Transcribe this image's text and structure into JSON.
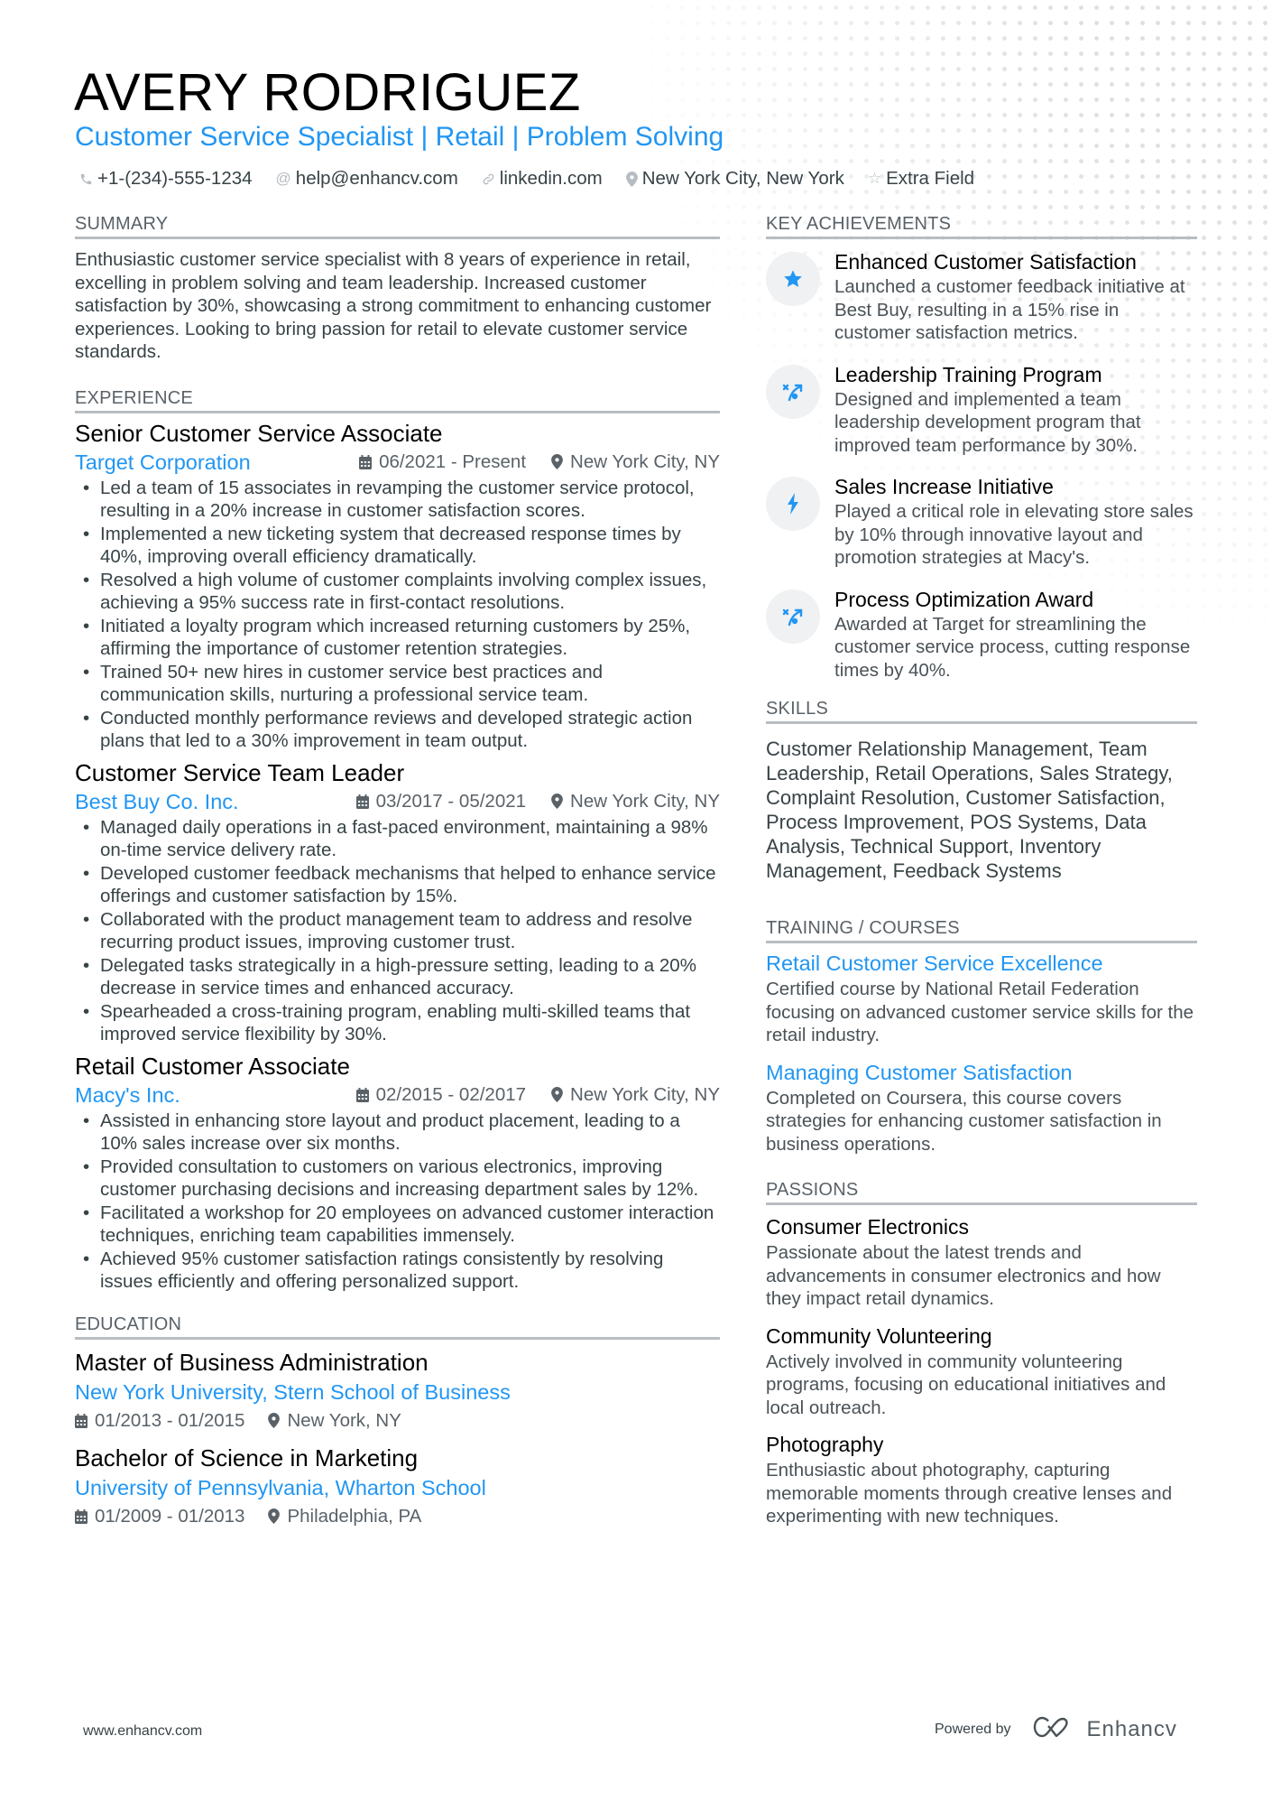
{
  "header": {
    "name": "AVERY RODRIGUEZ",
    "subtitle": "Customer Service Specialist | Retail | Problem Solving",
    "contacts": [
      {
        "icon": "phone-icon",
        "text": "+1-(234)-555-1234"
      },
      {
        "icon": "at-icon",
        "text": "help@enhancv.com"
      },
      {
        "icon": "link-icon",
        "text": "linkedin.com"
      },
      {
        "icon": "location-icon",
        "text": "New York City, New York"
      },
      {
        "icon": "star-outline-icon",
        "text": "Extra Field"
      }
    ]
  },
  "summary": {
    "title": "SUMMARY",
    "text": "Enthusiastic customer service specialist with 8 years of experience in retail, excelling in problem solving and team leadership. Increased customer satisfaction by 30%, showcasing a strong commitment to enhancing customer experiences. Looking to bring passion for retail to elevate customer service standards."
  },
  "experience": {
    "title": "EXPERIENCE",
    "jobs": [
      {
        "title": "Senior Customer Service Associate",
        "company": "Target Corporation",
        "dates": "06/2021 - Present",
        "location": "New York City, NY",
        "bullets": [
          "Led a team of 15 associates in revamping the customer service protocol, resulting in a 20% increase in customer satisfaction scores.",
          "Implemented a new ticketing system that decreased response times by 40%, improving overall efficiency dramatically.",
          "Resolved a high volume of customer complaints involving complex issues, achieving a 95% success rate in first-contact resolutions.",
          "Initiated a loyalty program which increased returning customers by 25%, affirming the importance of customer retention strategies.",
          "Trained 50+ new hires in customer service best practices and communication skills, nurturing a professional service team.",
          "Conducted monthly performance reviews and developed strategic action plans that led to a 30% improvement in team output."
        ]
      },
      {
        "title": "Customer Service Team Leader",
        "company": "Best Buy Co. Inc.",
        "dates": "03/2017 - 05/2021",
        "location": "New York City, NY",
        "bullets": [
          "Managed daily operations in a fast-paced environment, maintaining a 98% on-time service delivery rate.",
          "Developed customer feedback mechanisms that helped to enhance service offerings and customer satisfaction by 15%.",
          "Collaborated with the product management team to address and resolve recurring product issues, improving customer trust.",
          "Delegated tasks strategically in a high-pressure setting, leading to a 20% decrease in service times and enhanced accuracy.",
          "Spearheaded a cross-training program, enabling multi-skilled teams that improved service flexibility by 30%."
        ]
      },
      {
        "title": "Retail Customer Associate",
        "company": "Macy's Inc.",
        "dates": "02/2015 - 02/2017",
        "location": "New York City, NY",
        "bullets": [
          "Assisted in enhancing store layout and product placement, leading to a 10% sales increase over six months.",
          "Provided consultation to customers on various electronics, improving customer purchasing decisions and increasing department sales by 12%.",
          "Facilitated a workshop for 20 employees on advanced customer interaction techniques, enriching team capabilities immensely.",
          "Achieved 95% customer satisfaction ratings consistently by resolving issues efficiently and offering personalized support."
        ]
      }
    ]
  },
  "education": {
    "title": "EDUCATION",
    "items": [
      {
        "degree": "Master of Business Administration",
        "school": "New York University, Stern School of Business",
        "dates": "01/2013 - 01/2015",
        "location": "New York, NY"
      },
      {
        "degree": "Bachelor of Science in Marketing",
        "school": "University of Pennsylvania, Wharton School",
        "dates": "01/2009 - 01/2013",
        "location": "Philadelphia, PA"
      }
    ]
  },
  "achievements": {
    "title": "KEY ACHIEVEMENTS",
    "items": [
      {
        "icon": "star-icon",
        "title": "Enhanced Customer Satisfaction",
        "desc": "Launched a customer feedback initiative at Best Buy, resulting in a 15% rise in customer satisfaction metrics."
      },
      {
        "icon": "strategy-icon",
        "title": "Leadership Training Program",
        "desc": "Designed and implemented a team leadership development program that improved team performance by 30%."
      },
      {
        "icon": "lightning-icon",
        "title": "Sales Increase Initiative",
        "desc": "Played a critical role in elevating store sales by 10% through innovative layout and promotion strategies at Macy's."
      },
      {
        "icon": "strategy-icon",
        "title": "Process Optimization Award",
        "desc": "Awarded at Target for streamlining the customer service process, cutting response times by 40%."
      }
    ]
  },
  "skills": {
    "title": "SKILLS",
    "text": "Customer Relationship Management, Team Leadership, Retail Operations, Sales Strategy, Complaint Resolution, Customer Satisfaction, Process Improvement, POS Systems, Data Analysis, Technical Support, Inventory Management, Feedback Systems"
  },
  "training": {
    "title": "TRAINING / COURSES",
    "items": [
      {
        "title": "Retail Customer Service Excellence",
        "desc": "Certified course by National Retail Federation focusing on advanced customer service skills for the retail industry."
      },
      {
        "title": "Managing Customer Satisfaction",
        "desc": "Completed on Coursera, this course covers strategies for enhancing customer satisfaction in business operations."
      }
    ]
  },
  "passions": {
    "title": "PASSIONS",
    "items": [
      {
        "title": "Consumer Electronics",
        "desc": "Passionate about the latest trends and advancements in consumer electronics and how they impact retail dynamics."
      },
      {
        "title": "Community Volunteering",
        "desc": "Actively involved in community volunteering programs, focusing on educational initiatives and local outreach."
      },
      {
        "title": "Photography",
        "desc": "Enthusiastic about photography, capturing memorable moments through creative lenses and experimenting with new techniques."
      }
    ]
  },
  "footer": {
    "website": "www.enhancv.com",
    "powered_by": "Powered by",
    "brand": "Enhancv"
  },
  "colors": {
    "accent": "#2196f3",
    "text": "#384347",
    "heading": "#000000",
    "rule": "#b9bdc1",
    "icon_bg": "#f0f1f2"
  }
}
